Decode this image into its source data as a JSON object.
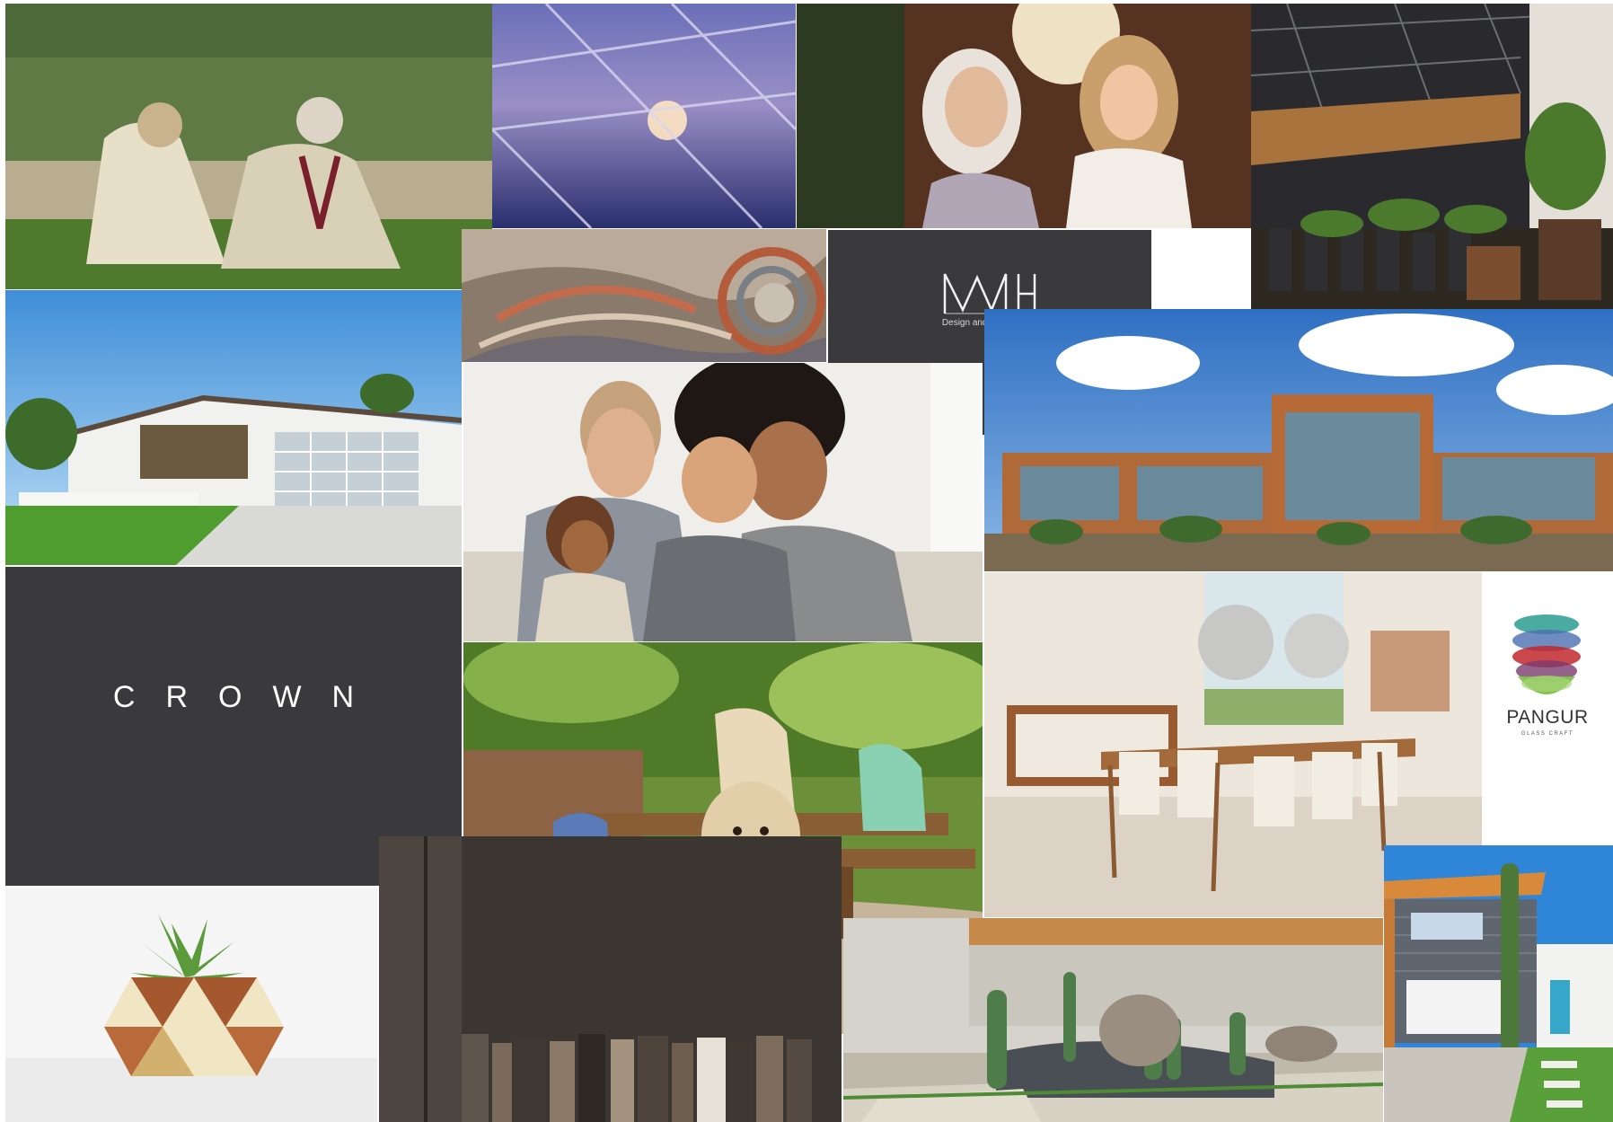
{
  "board": {
    "crown_logo": {
      "word": "CROWN"
    },
    "wmh_logo": {
      "tagline": "Design and Productions"
    },
    "pangur_logo": {
      "word": "PANGUR",
      "subtitle": "GLASS CRAFT"
    }
  },
  "colors": {
    "dark_panel": "#3a393b",
    "pangur_green": "#7cc242",
    "pangur_red": "#c1272d",
    "pangur_teal": "#2a9d8f"
  }
}
